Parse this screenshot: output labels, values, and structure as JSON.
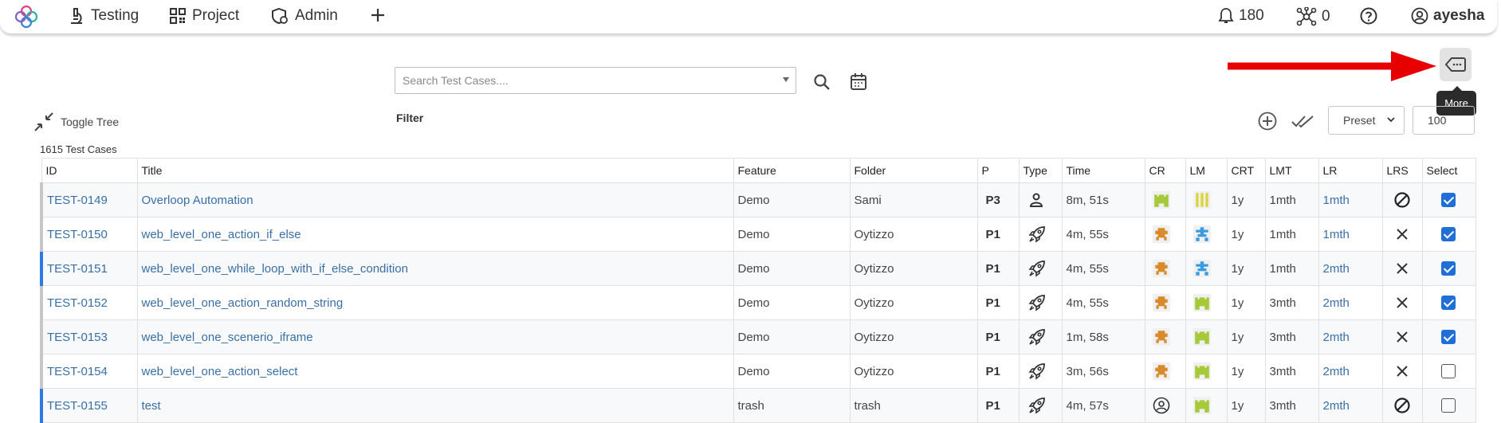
{
  "nav": {
    "testing": "Testing",
    "project": "Project",
    "admin": "Admin"
  },
  "topbar": {
    "notifications_count": "180",
    "network_count": "0",
    "username": "ayesha"
  },
  "search": {
    "placeholder": "Search Test Cases...."
  },
  "toolbar": {
    "toggle_tree": "Toggle Tree",
    "filter": "Filter",
    "preset": "Preset",
    "page_size": "100",
    "more_tooltip": "More"
  },
  "table": {
    "count": "1615 Test Cases",
    "columns": [
      "ID",
      "Title",
      "Feature",
      "Folder",
      "P",
      "Type",
      "Time",
      "CR",
      "LM",
      "CRT",
      "LMT",
      "LR",
      "LRS",
      "Select"
    ],
    "rows": [
      {
        "id": "TEST-0149",
        "title": "Overloop Automation",
        "feature": "Demo",
        "folder": "Sami",
        "p": "P3",
        "type": "person-icon",
        "time": "8m, 51s",
        "cr": "green-avatar",
        "lm": "yellow-avatar",
        "crt": "1y",
        "lmt": "1mth",
        "lr": "1mth",
        "lrs": "blocked-icon",
        "selected": true
      },
      {
        "id": "TEST-0150",
        "title": "web_level_one_action_if_else",
        "feature": "Demo",
        "folder": "Oytizzo",
        "p": "P1",
        "type": "rocket-icon",
        "time": "4m, 55s",
        "cr": "orange-avatar",
        "lm": "blue-avatar",
        "crt": "1y",
        "lmt": "1mth",
        "lr": "1mth",
        "lrs": "x-icon",
        "selected": true
      },
      {
        "id": "TEST-0151",
        "title": "web_level_one_while_loop_with_if_else_condition",
        "feature": "Demo",
        "folder": "Oytizzo",
        "p": "P1",
        "type": "rocket-icon",
        "time": "4m, 55s",
        "cr": "orange-avatar",
        "lm": "blue-avatar",
        "crt": "1y",
        "lmt": "1mth",
        "lr": "2mth",
        "lrs": "x-icon",
        "selected": true
      },
      {
        "id": "TEST-0152",
        "title": "web_level_one_action_random_string",
        "feature": "Demo",
        "folder": "Oytizzo",
        "p": "P1",
        "type": "rocket-icon",
        "time": "4m, 55s",
        "cr": "orange-avatar",
        "lm": "green-avatar",
        "crt": "1y",
        "lmt": "3mth",
        "lr": "2mth",
        "lrs": "x-icon",
        "selected": true
      },
      {
        "id": "TEST-0153",
        "title": "web_level_one_scenerio_iframe",
        "feature": "Demo",
        "folder": "Oytizzo",
        "p": "P1",
        "type": "rocket-icon",
        "time": "1m, 58s",
        "cr": "orange-avatar",
        "lm": "green-avatar",
        "crt": "1y",
        "lmt": "3mth",
        "lr": "2mth",
        "lrs": "x-icon",
        "selected": true
      },
      {
        "id": "TEST-0154",
        "title": "web_level_one_action_select",
        "feature": "Demo",
        "folder": "Oytizzo",
        "p": "P1",
        "type": "rocket-icon",
        "time": "3m, 56s",
        "cr": "orange-avatar",
        "lm": "green-avatar",
        "crt": "1y",
        "lmt": "3mth",
        "lr": "2mth",
        "lrs": "x-icon",
        "selected": false
      },
      {
        "id": "TEST-0155",
        "title": "test",
        "feature": "trash",
        "folder": "trash",
        "p": "P1",
        "type": "rocket-icon",
        "time": "4m, 57s",
        "cr": "user-circle-icon",
        "lm": "green-avatar",
        "crt": "1y",
        "lmt": "3mth",
        "lr": "2mth",
        "lrs": "blocked-icon",
        "selected": false
      }
    ]
  },
  "colors": {
    "accent": "#1f6fd6",
    "link": "#3a6fa5",
    "arrow": "#e60000",
    "avatar_green": "#a6c93a",
    "avatar_orange": "#d98a2b",
    "avatar_yellow": "#d8d43a",
    "avatar_blue": "#3a9be0"
  }
}
